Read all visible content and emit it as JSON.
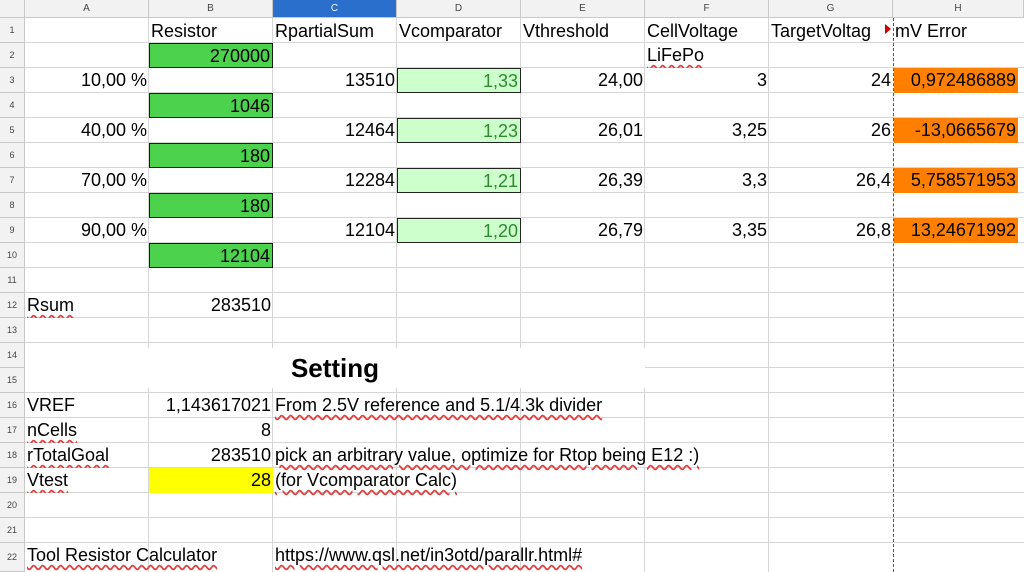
{
  "columns": [
    "A",
    "B",
    "C",
    "D",
    "E",
    "F",
    "G",
    "H"
  ],
  "selected_column": "C",
  "rows": [
    "1",
    "2",
    "3",
    "4",
    "5",
    "6",
    "7",
    "8",
    "9",
    "10",
    "11",
    "12",
    "13",
    "14",
    "15",
    "16",
    "17",
    "18",
    "19",
    "20",
    "21",
    "22"
  ],
  "header": {
    "B": "Resistor",
    "C": "RpartialSum",
    "D": "Vcomparator",
    "E": "Vthreshold",
    "F": "CellVoltage",
    "G": "TargetVoltag",
    "H": "mV Error",
    "F2": "LiFePo"
  },
  "resistors": [
    "270000",
    "1046",
    "180",
    "180",
    "12104"
  ],
  "table": [
    {
      "pct": "10,00 %",
      "partial": "13510",
      "vcomp": "1,33",
      "vthr": "24,00",
      "cell": "3",
      "target": "24",
      "err": "0,972486889"
    },
    {
      "pct": "40,00 %",
      "partial": "12464",
      "vcomp": "1,23",
      "vthr": "26,01",
      "cell": "3,25",
      "target": "26",
      "err": "-13,0665679"
    },
    {
      "pct": "70,00 %",
      "partial": "12284",
      "vcomp": "1,21",
      "vthr": "26,39",
      "cell": "3,3",
      "target": "26,4",
      "err": "5,758571953"
    },
    {
      "pct": "90,00 %",
      "partial": "12104",
      "vcomp": "1,20",
      "vthr": "26,79",
      "cell": "3,35",
      "target": "26,8",
      "err": "13,24671992"
    }
  ],
  "rsum": {
    "label": "Rsum",
    "value": "283510"
  },
  "setting_title": "Setting",
  "settings": [
    {
      "label": "VREF",
      "value": "1,143617021",
      "note": "From 2.5V reference and 5.1/4.3k divider"
    },
    {
      "label": "nCells",
      "value": "8",
      "note": ""
    },
    {
      "label": "rTotalGoal",
      "value": "283510",
      "note": "pick an arbitrary value, optimize for Rtop being E12 :)"
    },
    {
      "label": "Vtest",
      "value": "28",
      "note": "(for Vcomparator Calc)"
    }
  ],
  "tool": {
    "label": "Tool Resistor Calculator",
    "url": "https://www.qsl.net/in3otd/parallr.html#"
  },
  "colors": {
    "green": "#4cd24c",
    "light_green": "#ccffcc",
    "orange": "#ff8000",
    "yellow": "#ffff00",
    "selected_header": "#2a6fcc"
  }
}
